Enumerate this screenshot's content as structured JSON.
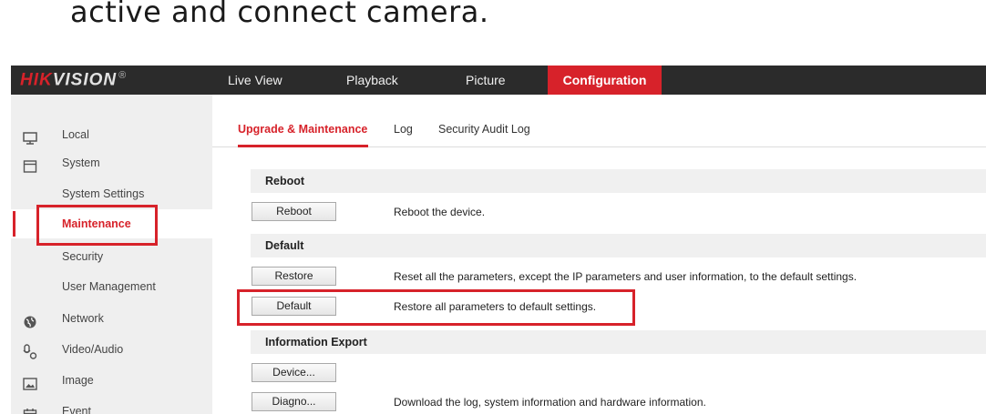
{
  "caption": "active and connect camera.",
  "header": {
    "logo": {
      "brand_red": "HIK",
      "brand_rest": "VISION",
      "mark": "®"
    },
    "nav": [
      {
        "label": "Live View"
      },
      {
        "label": "Playback"
      },
      {
        "label": "Picture"
      },
      {
        "label": "Configuration",
        "active": true
      }
    ]
  },
  "sidebar": {
    "items": [
      {
        "label": "Local",
        "icon": "monitor-icon"
      },
      {
        "label": "System",
        "icon": "window-icon"
      },
      {
        "label": "System Settings"
      },
      {
        "label": "Maintenance",
        "active": true
      },
      {
        "label": "Security"
      },
      {
        "label": "User Management"
      },
      {
        "label": "Network",
        "icon": "globe-icon"
      },
      {
        "label": "Video/Audio",
        "icon": "microphone-icon"
      },
      {
        "label": "Image",
        "icon": "image-icon"
      },
      {
        "label": "Event",
        "icon": "calendar-icon"
      }
    ]
  },
  "tabs": [
    {
      "label": "Upgrade & Maintenance",
      "active": true
    },
    {
      "label": "Log"
    },
    {
      "label": "Security Audit Log"
    }
  ],
  "sections": {
    "reboot": {
      "title": "Reboot",
      "button": "Reboot",
      "description": "Reboot the device."
    },
    "default": {
      "title": "Default",
      "restore_button": "Restore",
      "restore_description": "Reset all the parameters, except the IP parameters and user information, to the default settings.",
      "default_button": "Default",
      "default_description": "Restore all parameters to default settings."
    },
    "export": {
      "title": "Information Export",
      "device_button": "Device...",
      "diagnose_button": "Diagno...",
      "diagnose_description": "Download the log, system information and hardware information."
    }
  },
  "colors": {
    "accent": "#d7222a",
    "topbar": "#2b2b2b",
    "sidebar": "#efefef",
    "highlight": "#d7222a"
  }
}
